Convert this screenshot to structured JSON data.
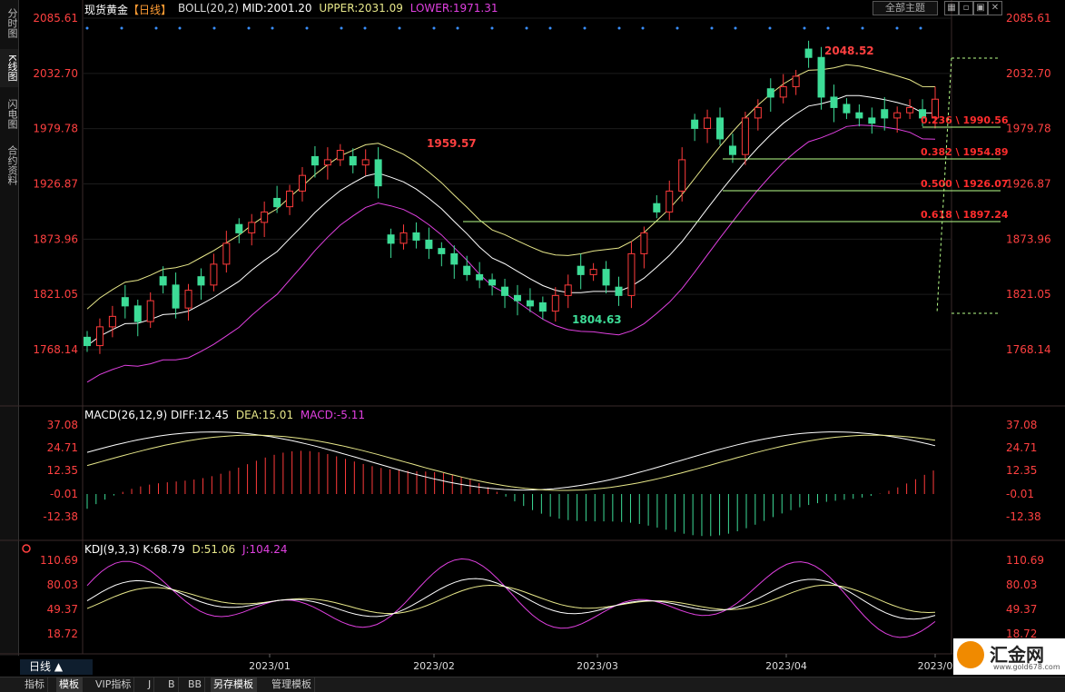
{
  "instrument": "现货黄金",
  "period_tag": "【日线】",
  "left_tabs": [
    "分时图",
    "K线图",
    "闪电图",
    "合约资料"
  ],
  "theme_button": "全部主题",
  "boll": {
    "label": "BOLL(20,2)",
    "mid": "MID:2001.20",
    "upper": "UPPER:2031.09",
    "lower": "LOWER:1971.31"
  },
  "macd": {
    "label": "MACD(26,12,9)",
    "diff": "DIFF:12.45",
    "dea": "DEA:15.01",
    "macd": "MACD:-5.11"
  },
  "kdj": {
    "label": "KDJ(9,3,3)",
    "k": "K:68.79",
    "d": "D:51.06",
    "j": "J:104.24"
  },
  "price_axis": [
    "2085.61",
    "2032.70",
    "1979.78",
    "1926.87",
    "1873.96",
    "1821.05",
    "1768.14"
  ],
  "macd_axis": [
    "37.08",
    "24.71",
    "12.35",
    "-0.01",
    "-12.38"
  ],
  "kdj_axis": [
    "110.69",
    "80.03",
    "49.37",
    "18.72"
  ],
  "date_axis": [
    "2023/01",
    "2023/02",
    "2023/03",
    "2023/04",
    "2023/0"
  ],
  "annotations": {
    "high": "2048.52",
    "peak1": "1959.57",
    "low": "1804.63"
  },
  "fib_levels": [
    {
      "ratio": "0.236",
      "price": "1990.56"
    },
    {
      "ratio": "0.382",
      "price": "1954.89"
    },
    {
      "ratio": "0.500",
      "price": "1926.07"
    },
    {
      "ratio": "0.618",
      "price": "1897.24"
    }
  ],
  "period_button": "日线 ▲",
  "bottom_tabs": [
    "指标",
    "模板",
    "VIP指标",
    "J",
    "B",
    "BB",
    "另存模板",
    "管理模板"
  ],
  "logo": {
    "brand": "汇金网",
    "url": "www.gold678.com"
  },
  "colors": {
    "up": "#ff3b3b",
    "down": "#3ddc97",
    "upper": "#e8e88a",
    "mid": "#ffffff",
    "lower": "#e040e0",
    "fib": "#ff2d2d",
    "axis_red": "#ff4040"
  },
  "chart_data": {
    "type": "candlestick",
    "price_range": [
      1768.14,
      2085.61
    ],
    "note_series": [
      "BOLL upper",
      "BOLL mid",
      "BOLL lower"
    ],
    "closes_approx": [
      1772,
      1790,
      1800,
      1810,
      1795,
      1815,
      1830,
      1808,
      1825,
      1830,
      1850,
      1870,
      1880,
      1890,
      1900,
      1905,
      1920,
      1935,
      1945,
      1950,
      1959,
      1945,
      1950,
      1925,
      1870,
      1880,
      1873,
      1865,
      1860,
      1850,
      1840,
      1835,
      1830,
      1820,
      1815,
      1810,
      1805,
      1820,
      1830,
      1840,
      1845,
      1830,
      1820,
      1860,
      1880,
      1900,
      1920,
      1950,
      1980,
      1990,
      1970,
      1955,
      1990,
      2000,
      2010,
      2020,
      2030,
      2048,
      2010,
      2000,
      1995,
      1990,
      1985,
      1990,
      1995,
      2000,
      1990,
      2008
    ],
    "fib_lines": [
      1990.56,
      1954.89,
      1926.07,
      1897.24
    ]
  }
}
